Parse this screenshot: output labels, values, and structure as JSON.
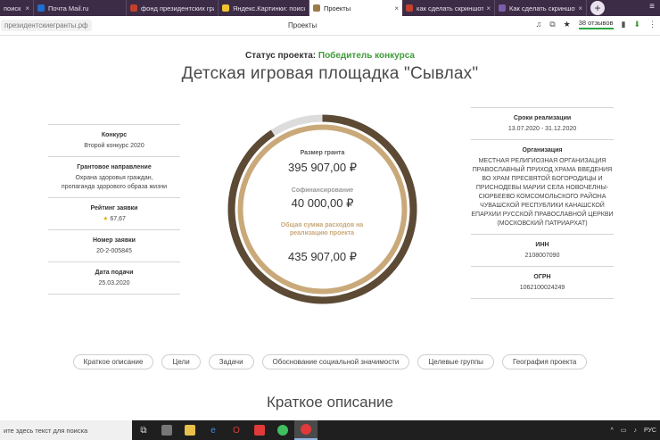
{
  "browser": {
    "tabs": [
      {
        "label": "поиск в ",
        "color": "#c2412d",
        "active": false
      },
      {
        "label": "Почта Mail.ru",
        "color": "#1f6fd1",
        "active": false
      },
      {
        "label": "фонд президентских гра",
        "color": "#c2412d",
        "active": false
      },
      {
        "label": "Яндекс.Картинки: поиск",
        "color": "#f2c230",
        "active": false
      },
      {
        "label": "Проекты",
        "color": "#9c7a4a",
        "active": true
      },
      {
        "label": "как сделать скриншот н",
        "color": "#c2412d",
        "active": false
      },
      {
        "label": "Как сделать скриншот э",
        "color": "#7b5ea7",
        "active": false
      }
    ],
    "new_tab": "+",
    "menu": "≡",
    "url": "президентскиегранты.рф",
    "page_title": "Проекты",
    "reviews": "38 отзывов"
  },
  "project": {
    "status_label": "Статус проекта:",
    "status_value": "Победитель конкурса",
    "title": "Детская игровая площадка \"Сывлах\""
  },
  "left_info": [
    {
      "head": "Конкурс",
      "value": "Второй конкурс 2020"
    },
    {
      "head": "Грантовое направление",
      "value": "Охрана здоровья граждан, пропаганда здорового образа жизни"
    },
    {
      "head": "Рейтинг заявки",
      "value": "67,67",
      "star": true
    },
    {
      "head": "Номер заявки",
      "value": "20-2-005845"
    },
    {
      "head": "Дата подачи",
      "value": "25.03.2020"
    }
  ],
  "right_info": [
    {
      "head": "Сроки реализации",
      "value": "13.07.2020 - 31.12.2020"
    },
    {
      "head": "Организация",
      "value": "МЕСТНАЯ РЕЛИГИОЗНАЯ ОРГАНИЗАЦИЯ ПРАВОСЛАВНЫЙ ПРИХОД ХРАМА ВВЕДЕНИЯ ВО ХРАМ ПРЕСВЯТОЙ БОГОРОДИЦЫ И ПРИСНОДЕВЫ МАРИИ СЕЛА НОВОЧЕЛНЫ-СЮРБЕЕВО КОМСОМОЛЬСКОГО РАЙОНА ЧУВАШСКОЙ РЕСПУБЛИКИ КАНАШСКОЙ ЕПАРХИИ РУССКОЙ ПРАВОСЛАВНОЙ ЦЕРКВИ (МОСКОВСКИЙ ПАТРИАРХАТ)"
    },
    {
      "head": "ИНН",
      "value": "2108007090"
    },
    {
      "head": "ОГРН",
      "value": "1062100024249"
    }
  ],
  "finance": {
    "grant_label": "Размер гранта",
    "grant_value": "395 907,00 ₽",
    "cofin_label": "Софинансирование",
    "cofin_value": "40 000,00 ₽",
    "total_label": "Общая сумма расходов на реализацию проекта",
    "total_value": "435 907,00 ₽",
    "grant_share": 0.908,
    "colors": {
      "grant": "#5c4a35",
      "cofin": "#dcdcdc",
      "inner": "#c9a97a"
    }
  },
  "tabs": [
    "Краткое описание",
    "Цели",
    "Задачи",
    "Обоснование социальной значимости",
    "Целевые группы",
    "География проекта"
  ],
  "section_title": "Краткое описание",
  "taskbar": {
    "search_placeholder": "ите здесь текст для поиска",
    "language": "РУС"
  }
}
